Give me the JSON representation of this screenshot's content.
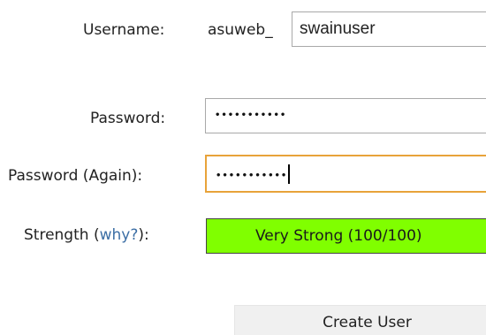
{
  "form": {
    "username": {
      "label": "Username:",
      "prefix": "asuweb_",
      "value": "swainuser"
    },
    "password": {
      "label": "Password:",
      "masked_value": "•••••••••••"
    },
    "password_again": {
      "label": "Password (Again):",
      "masked_value": "•••••••••••",
      "focused": true
    },
    "strength": {
      "label_prefix": "Strength (",
      "link_text": "why?",
      "label_suffix": "):",
      "text": "Very Strong (100/100)",
      "score": 100,
      "max_score": 100,
      "color": "#80ff00"
    },
    "submit_label": "Create User"
  },
  "colors": {
    "focus_border": "#e8a33a",
    "link": "#3b6ea5",
    "strength_fill": "#80ff00"
  }
}
